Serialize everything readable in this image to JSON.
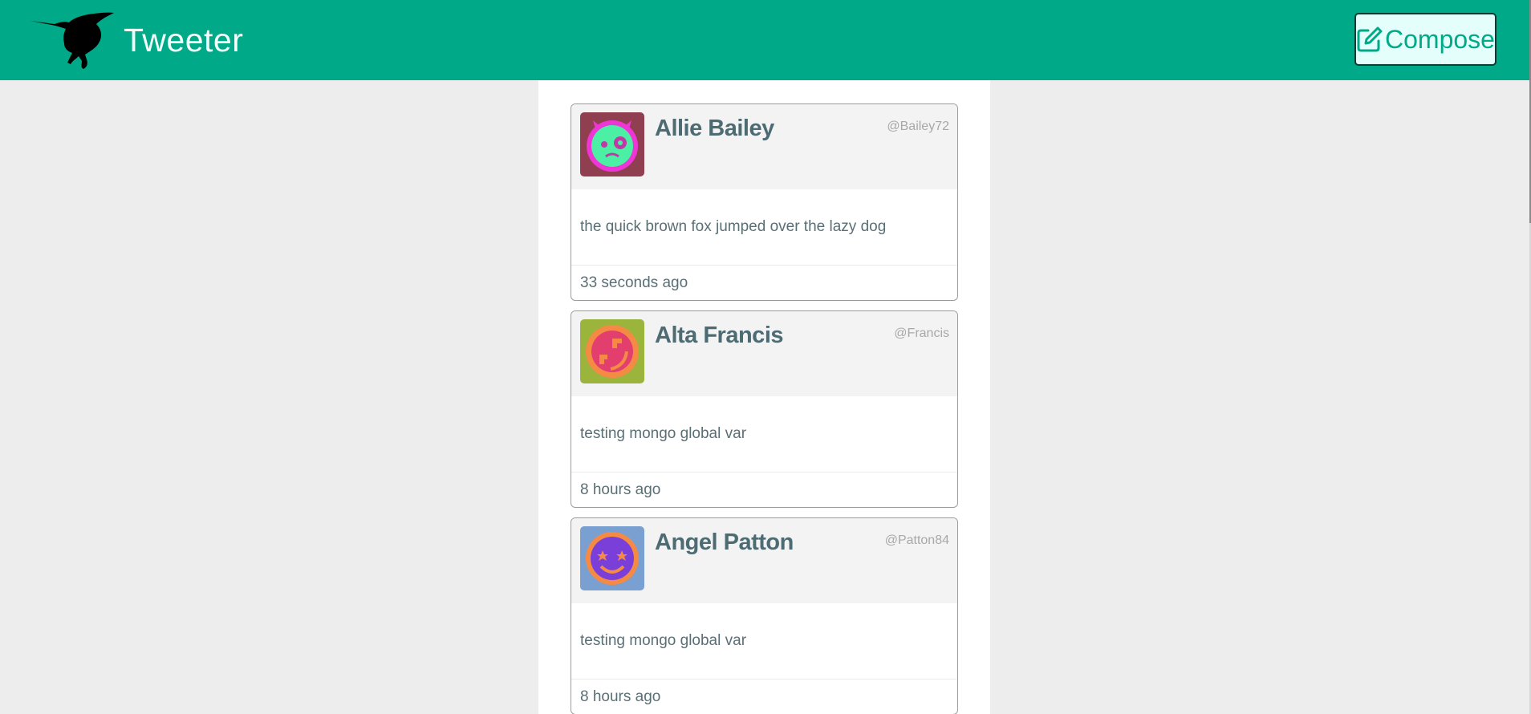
{
  "header": {
    "app_title": "Tweeter",
    "logo_icon": "hummingbird-icon",
    "compose_label": "Compose",
    "compose_icon": "edit-icon",
    "background_color": "#00a987"
  },
  "tweets": [
    {
      "name": "Allie Bailey",
      "handle": "@Bailey72",
      "text": "the quick brown fox jumped over the lazy dog",
      "time": "33 seconds ago",
      "avatar_icon": "devil-face-avatar"
    },
    {
      "name": "Alta Francis",
      "handle": "@Francis",
      "text": "testing mongo global var",
      "time": "8 hours ago",
      "avatar_icon": "tilted-face-avatar"
    },
    {
      "name": "Angel Patton",
      "handle": "@Patton84",
      "text": "testing mongo global var",
      "time": "8 hours ago",
      "avatar_icon": "star-eyes-face-avatar"
    }
  ]
}
